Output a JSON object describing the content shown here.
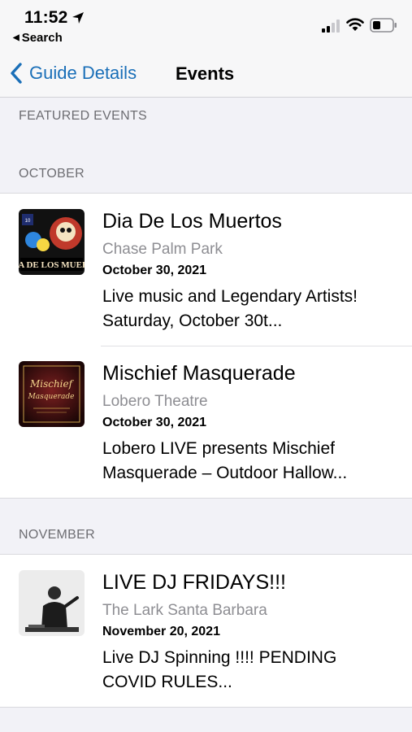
{
  "status_bar": {
    "time": "11:52",
    "back_app": "Search",
    "icons": [
      "location-arrow-icon",
      "signal-icon",
      "wifi-icon",
      "battery-icon"
    ]
  },
  "nav": {
    "back_label": "Guide Details",
    "title": "Events",
    "accent_color": "#1a6fb8"
  },
  "sections": {
    "featured": "FEATURED EVENTS",
    "october": "OCTOBER",
    "november": "NOVEMBER"
  },
  "events": [
    {
      "title": "Dia De Los Muertos",
      "venue": "Chase Palm Park",
      "date": "October 30, 2021",
      "description": "Live music and Legendary Artists! Saturday, October 30t...",
      "thumb_text": "DIA DE LOS MUERT"
    },
    {
      "title": "Mischief Masquerade",
      "venue": "Lobero Theatre",
      "date": "October 30, 2021",
      "description": "Lobero LIVE presents Mischief Masquerade – Outdoor Hallow...",
      "thumb_text": "Mischief Masquerade"
    },
    {
      "title": "LIVE DJ FRIDAYS!!!",
      "venue": "The Lark Santa Barbara",
      "date": "November 20, 2021",
      "description": "Live DJ Spinning !!!! PENDING COVID RULES..."
    }
  ]
}
